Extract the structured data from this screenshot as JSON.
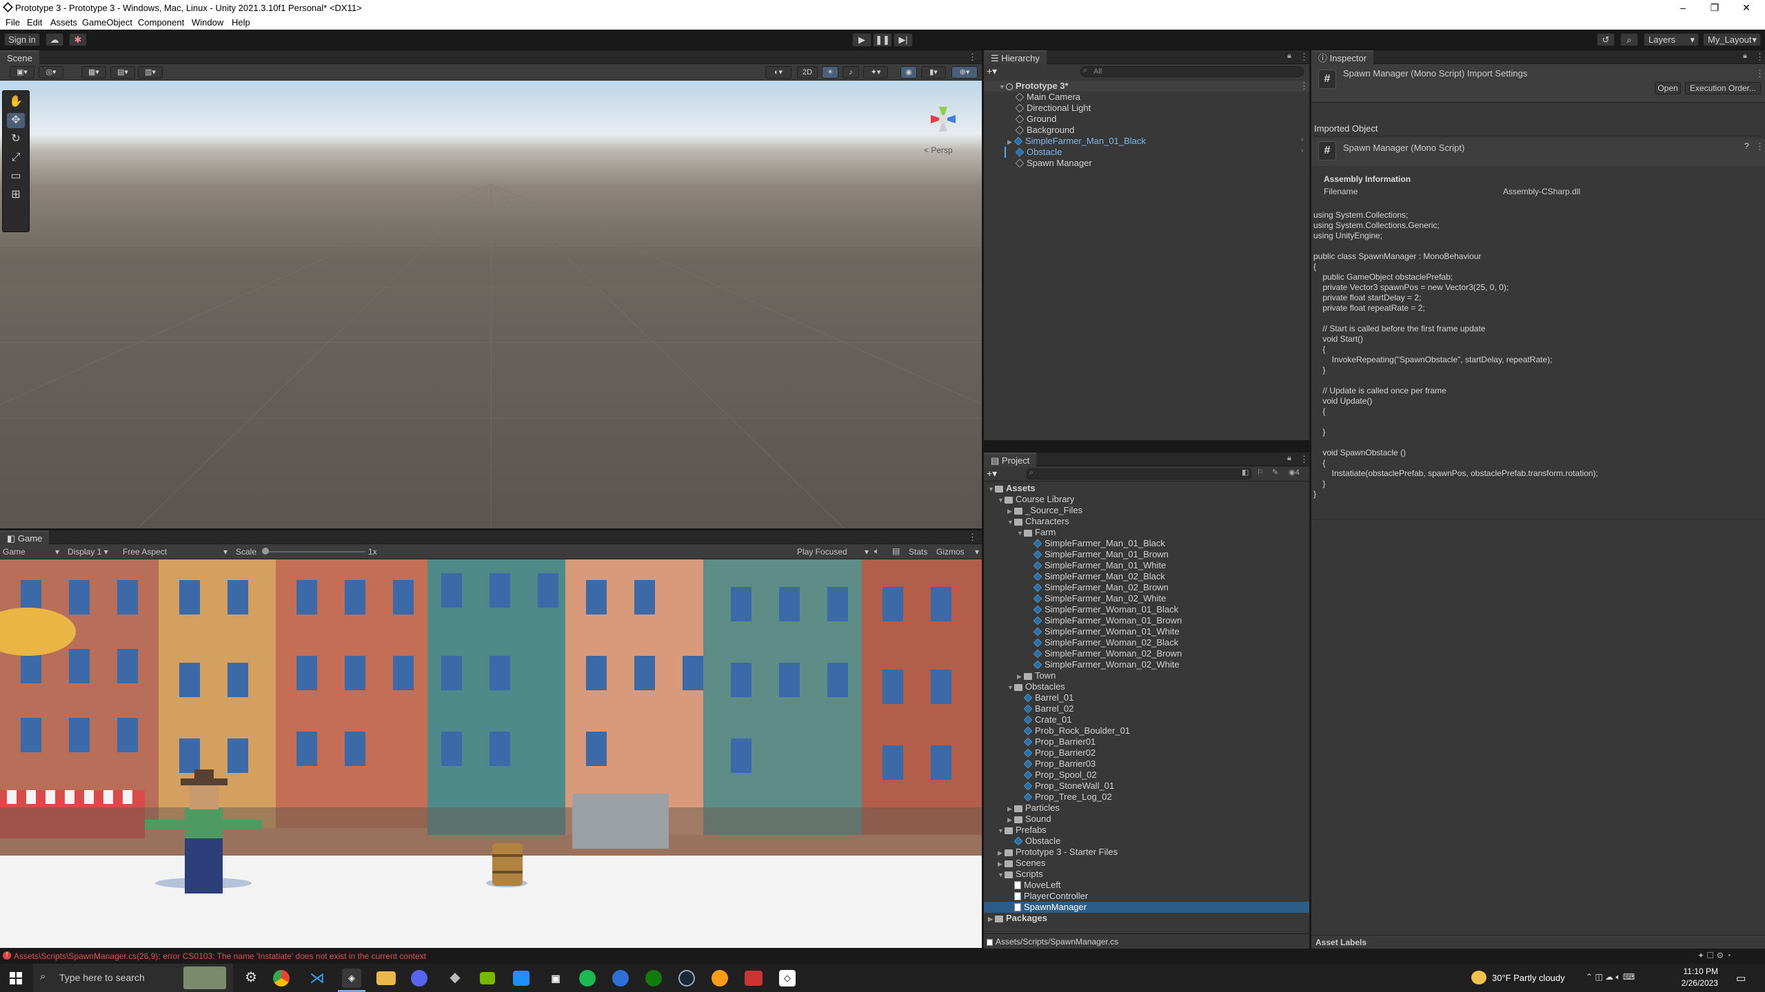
{
  "window": {
    "title": "Prototype 3 - Prototype 3 - Windows, Mac, Linux - Unity 2021.3.10f1 Personal* <DX11>",
    "controls": {
      "minimize": "–",
      "maximize": "❐",
      "close": "✕"
    }
  },
  "menu": [
    "File",
    "Edit",
    "Assets",
    "GameObject",
    "Component",
    "Window",
    "Help"
  ],
  "toolbar": {
    "sign_in": "Sign in",
    "layers": "Layers",
    "layout": "My_Layout"
  },
  "scene": {
    "tab": "Scene",
    "btn_2d": "2D",
    "persp": "< Persp"
  },
  "game": {
    "tab": "Game",
    "mode": "Game",
    "display": "Display 1",
    "aspect": "Free Aspect",
    "scale_label": "Scale",
    "scale_value": "1x",
    "play_focused": "Play Focused",
    "stats": "Stats",
    "gizmos": "Gizmos"
  },
  "hierarchy": {
    "tab": "Hierarchy",
    "search_placeholder": "All",
    "scene_name": "Prototype 3*",
    "items": [
      "Main Camera",
      "Directional Light",
      "Ground",
      "Background",
      "SimpleFarmer_Man_01_Black",
      "Obstacle",
      "Spawn Manager"
    ]
  },
  "project": {
    "tab": "Project",
    "badge": "4",
    "tree": [
      {
        "label": "Assets",
        "depth": 0,
        "kind": "folder",
        "open": true,
        "bold": true
      },
      {
        "label": "Course Library",
        "depth": 1,
        "kind": "folder",
        "open": true
      },
      {
        "label": "_Source_Files",
        "depth": 2,
        "kind": "folder",
        "open": false
      },
      {
        "label": "Characters",
        "depth": 2,
        "kind": "folder",
        "open": true
      },
      {
        "label": "Farm",
        "depth": 3,
        "kind": "folder",
        "open": true
      },
      {
        "label": "SimpleFarmer_Man_01_Black",
        "depth": 4,
        "kind": "prefab"
      },
      {
        "label": "SimpleFarmer_Man_01_Brown",
        "depth": 4,
        "kind": "prefab"
      },
      {
        "label": "SimpleFarmer_Man_01_White",
        "depth": 4,
        "kind": "prefab"
      },
      {
        "label": "SimpleFarmer_Man_02_Black",
        "depth": 4,
        "kind": "prefab"
      },
      {
        "label": "SimpleFarmer_Man_02_Brown",
        "depth": 4,
        "kind": "prefab"
      },
      {
        "label": "SimpleFarmer_Man_02_White",
        "depth": 4,
        "kind": "prefab"
      },
      {
        "label": "SimpleFarmer_Woman_01_Black",
        "depth": 4,
        "kind": "prefab"
      },
      {
        "label": "SimpleFarmer_Woman_01_Brown",
        "depth": 4,
        "kind": "prefab"
      },
      {
        "label": "SimpleFarmer_Woman_01_White",
        "depth": 4,
        "kind": "prefab"
      },
      {
        "label": "SimpleFarmer_Woman_02_Black",
        "depth": 4,
        "kind": "prefab"
      },
      {
        "label": "SimpleFarmer_Woman_02_Brown",
        "depth": 4,
        "kind": "prefab"
      },
      {
        "label": "SimpleFarmer_Woman_02_White",
        "depth": 4,
        "kind": "prefab"
      },
      {
        "label": "Town",
        "depth": 3,
        "kind": "folder",
        "open": false
      },
      {
        "label": "Obstacles",
        "depth": 2,
        "kind": "folder",
        "open": true
      },
      {
        "label": "Barrel_01",
        "depth": 3,
        "kind": "prefab"
      },
      {
        "label": "Barrel_02",
        "depth": 3,
        "kind": "prefab"
      },
      {
        "label": "Crate_01",
        "depth": 3,
        "kind": "prefab"
      },
      {
        "label": "Prob_Rock_Boulder_01",
        "depth": 3,
        "kind": "prefab"
      },
      {
        "label": "Prop_Barrier01",
        "depth": 3,
        "kind": "prefab"
      },
      {
        "label": "Prop_Barrier02",
        "depth": 3,
        "kind": "prefab"
      },
      {
        "label": "Prop_Barrier03",
        "depth": 3,
        "kind": "prefab"
      },
      {
        "label": "Prop_Spool_02",
        "depth": 3,
        "kind": "prefab"
      },
      {
        "label": "Prop_StoneWall_01",
        "depth": 3,
        "kind": "prefab"
      },
      {
        "label": "Prop_Tree_Log_02",
        "depth": 3,
        "kind": "prefab"
      },
      {
        "label": "Particles",
        "depth": 2,
        "kind": "folder",
        "open": false
      },
      {
        "label": "Sound",
        "depth": 2,
        "kind": "folder",
        "open": false
      },
      {
        "label": "Prefabs",
        "depth": 1,
        "kind": "folder",
        "open": true
      },
      {
        "label": "Obstacle",
        "depth": 2,
        "kind": "prefab"
      },
      {
        "label": "Prototype 3 - Starter Files",
        "depth": 1,
        "kind": "folder",
        "open": false
      },
      {
        "label": "Scenes",
        "depth": 1,
        "kind": "folder",
        "open": false
      },
      {
        "label": "Scripts",
        "depth": 1,
        "kind": "folder",
        "open": true
      },
      {
        "label": "MoveLeft",
        "depth": 2,
        "kind": "script"
      },
      {
        "label": "PlayerController",
        "depth": 2,
        "kind": "script"
      },
      {
        "label": "SpawnManager",
        "depth": 2,
        "kind": "script",
        "selected": true
      },
      {
        "label": "Packages",
        "depth": 0,
        "kind": "folder",
        "open": false,
        "bold": true
      }
    ],
    "path": "Assets/Scripts/SpawnManager.cs"
  },
  "inspector": {
    "tab": "Inspector",
    "header_title": "Spawn Manager (Mono Script) Import Settings",
    "open_btn": "Open",
    "exec_btn": "Execution Order...",
    "imported_label": "Imported Object",
    "object_title": "Spawn Manager (Mono Script)",
    "assembly_title": "Assembly Information",
    "filename_label": "Filename",
    "filename_value": "Assembly-CSharp.dll",
    "code": "using System.Collections;\nusing System.Collections.Generic;\nusing UnityEngine;\n\npublic class SpawnManager : MonoBehaviour\n{\n    public GameObject obstaclePrefab;\n    private Vector3 spawnPos = new Vector3(25, 0, 0);\n    private float startDelay = 2;\n    private float repeatRate = 2;\n\n    // Start is called before the first frame update\n    void Start()\n    {\n        InvokeRepeating(\"SpawnObstacle\", startDelay, repeatRate);\n    }\n\n    // Update is called once per frame\n    void Update()\n    {\n\n    }\n\n    void SpawnObstacle ()\n    {\n        Instatiate(obstaclePrefab, spawnPos, obstaclePrefab.transform.rotation);\n    }\n}",
    "asset_labels": "Asset Labels"
  },
  "status": {
    "error": "Assets\\Scripts\\SpawnManager.cs(26,9): error CS0103: The name 'Instatiate' does not exist in the current context"
  },
  "taskbar": {
    "search_placeholder": "Type here to search",
    "weather": "30°F  Partly cloudy",
    "time": "11:10 PM",
    "date": "2/26/2023"
  },
  "colors": {
    "accent": "#2c5d87",
    "selection": "#2c5d87",
    "error": "#ff5555",
    "prefab_blue": "#7fb8ef"
  }
}
